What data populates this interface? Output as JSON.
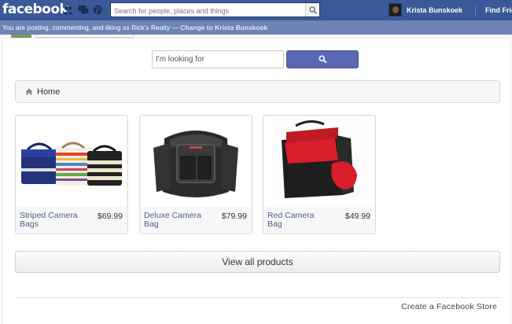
{
  "topbar": {
    "logo": "facebook",
    "search_placeholder": "Search for people, places and things",
    "profile_name": "Krista Bunskoek",
    "find_friends": "Find Frie"
  },
  "posting_bar": {
    "text": "You are posting, commenting, and liking as Rick's Realty — ",
    "switch_link": "Change to Krista Bunskoek"
  },
  "store": {
    "search_placeholder": "I'm looking for",
    "search_button_icon": "search-icon",
    "breadcrumb": {
      "icon": "home-icon",
      "label": "Home"
    },
    "products": [
      {
        "name": "Striped Camera Bags",
        "price": "$69.99"
      },
      {
        "name": "Deluxe Camera Bag",
        "price": "$79.99"
      },
      {
        "name": "Red Camera Bag",
        "price": "$49.99"
      }
    ],
    "view_all_label": "View all products",
    "create_store_label": "Create a Facebook Store"
  },
  "colors": {
    "facebook_blue": "#3b5998",
    "posting_bar": "#6d84b4",
    "search_button": "#5b67b0",
    "product_link": "#4a5f8a"
  }
}
